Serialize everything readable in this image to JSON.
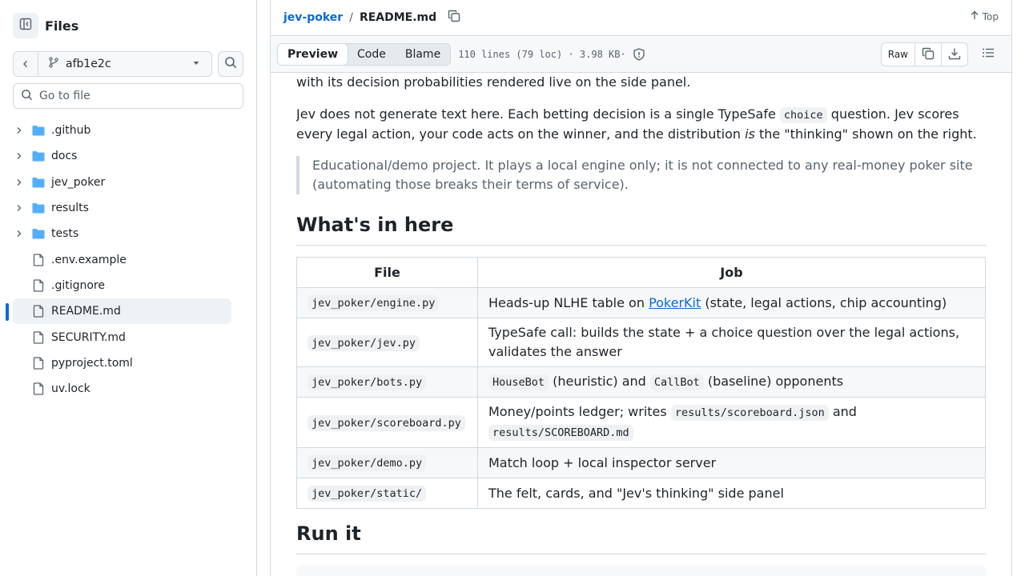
{
  "sidebar": {
    "title": "Files",
    "branch": "afb1e2c",
    "goto_placeholder": "Go to file",
    "tree": [
      {
        "name": ".github",
        "type": "folder"
      },
      {
        "name": "docs",
        "type": "folder"
      },
      {
        "name": "jev_poker",
        "type": "folder"
      },
      {
        "name": "results",
        "type": "folder"
      },
      {
        "name": "tests",
        "type": "folder"
      },
      {
        "name": ".env.example",
        "type": "file"
      },
      {
        "name": ".gitignore",
        "type": "file"
      },
      {
        "name": "README.md",
        "type": "file",
        "selected": true
      },
      {
        "name": "SECURITY.md",
        "type": "file"
      },
      {
        "name": "pyproject.toml",
        "type": "file"
      },
      {
        "name": "uv.lock",
        "type": "file"
      }
    ]
  },
  "header": {
    "repo": "jev-poker",
    "sep": "/",
    "file": "README.md",
    "top_label": "Top"
  },
  "toolbar": {
    "tabs": [
      "Preview",
      "Code",
      "Blame"
    ],
    "active_tab": "Preview",
    "meta": "110 lines (79 loc) · 3.98 KB·",
    "raw_label": "Raw"
  },
  "readme": {
    "p1": "with its decision probabilities rendered live on the side panel.",
    "p2": {
      "a": "Jev does not generate text here. Each betting decision is a single TypeSafe ",
      "code": "choice",
      "b": " question. Jev scores every legal action, your code acts on the winner, and the distribution ",
      "em": "is",
      "c": " the \"thinking\" shown on the right."
    },
    "quote": "Educational/demo project. It plays a local engine only; it is not connected to any real-money poker site (automating those breaks their terms of service).",
    "h2_a": "What's in here",
    "h2_b": "Run it",
    "table": {
      "headers": [
        "File",
        "Job"
      ],
      "rows": [
        {
          "file": "jev_poker/engine.py",
          "job_a": "Heads-up NLHE table on ",
          "job_link": "PokerKit",
          "job_b": " (state, legal actions, chip accounting)"
        },
        {
          "file": "jev_poker/jev.py",
          "job_a": "TypeSafe call: builds the state + a choice question over the legal actions, validates the answer"
        },
        {
          "file": "jev_poker/bots.py",
          "job_code1": "HouseBot",
          "job_a": " (heuristic) and ",
          "job_code2": "CallBot",
          "job_b": " (baseline) opponents"
        },
        {
          "file": "jev_poker/scoreboard.py",
          "job_a": "Money/points ledger; writes ",
          "job_code1": "results/scoreboard.json",
          "job_b": " and ",
          "job_code2": "results/SCOREBOARD.md"
        },
        {
          "file": "jev_poker/demo.py",
          "job_a": "Match loop + local inspector server"
        },
        {
          "file": "jev_poker/static/",
          "job_a": "The felt, cards, and \"Jev's thinking\" side panel"
        }
      ]
    }
  }
}
